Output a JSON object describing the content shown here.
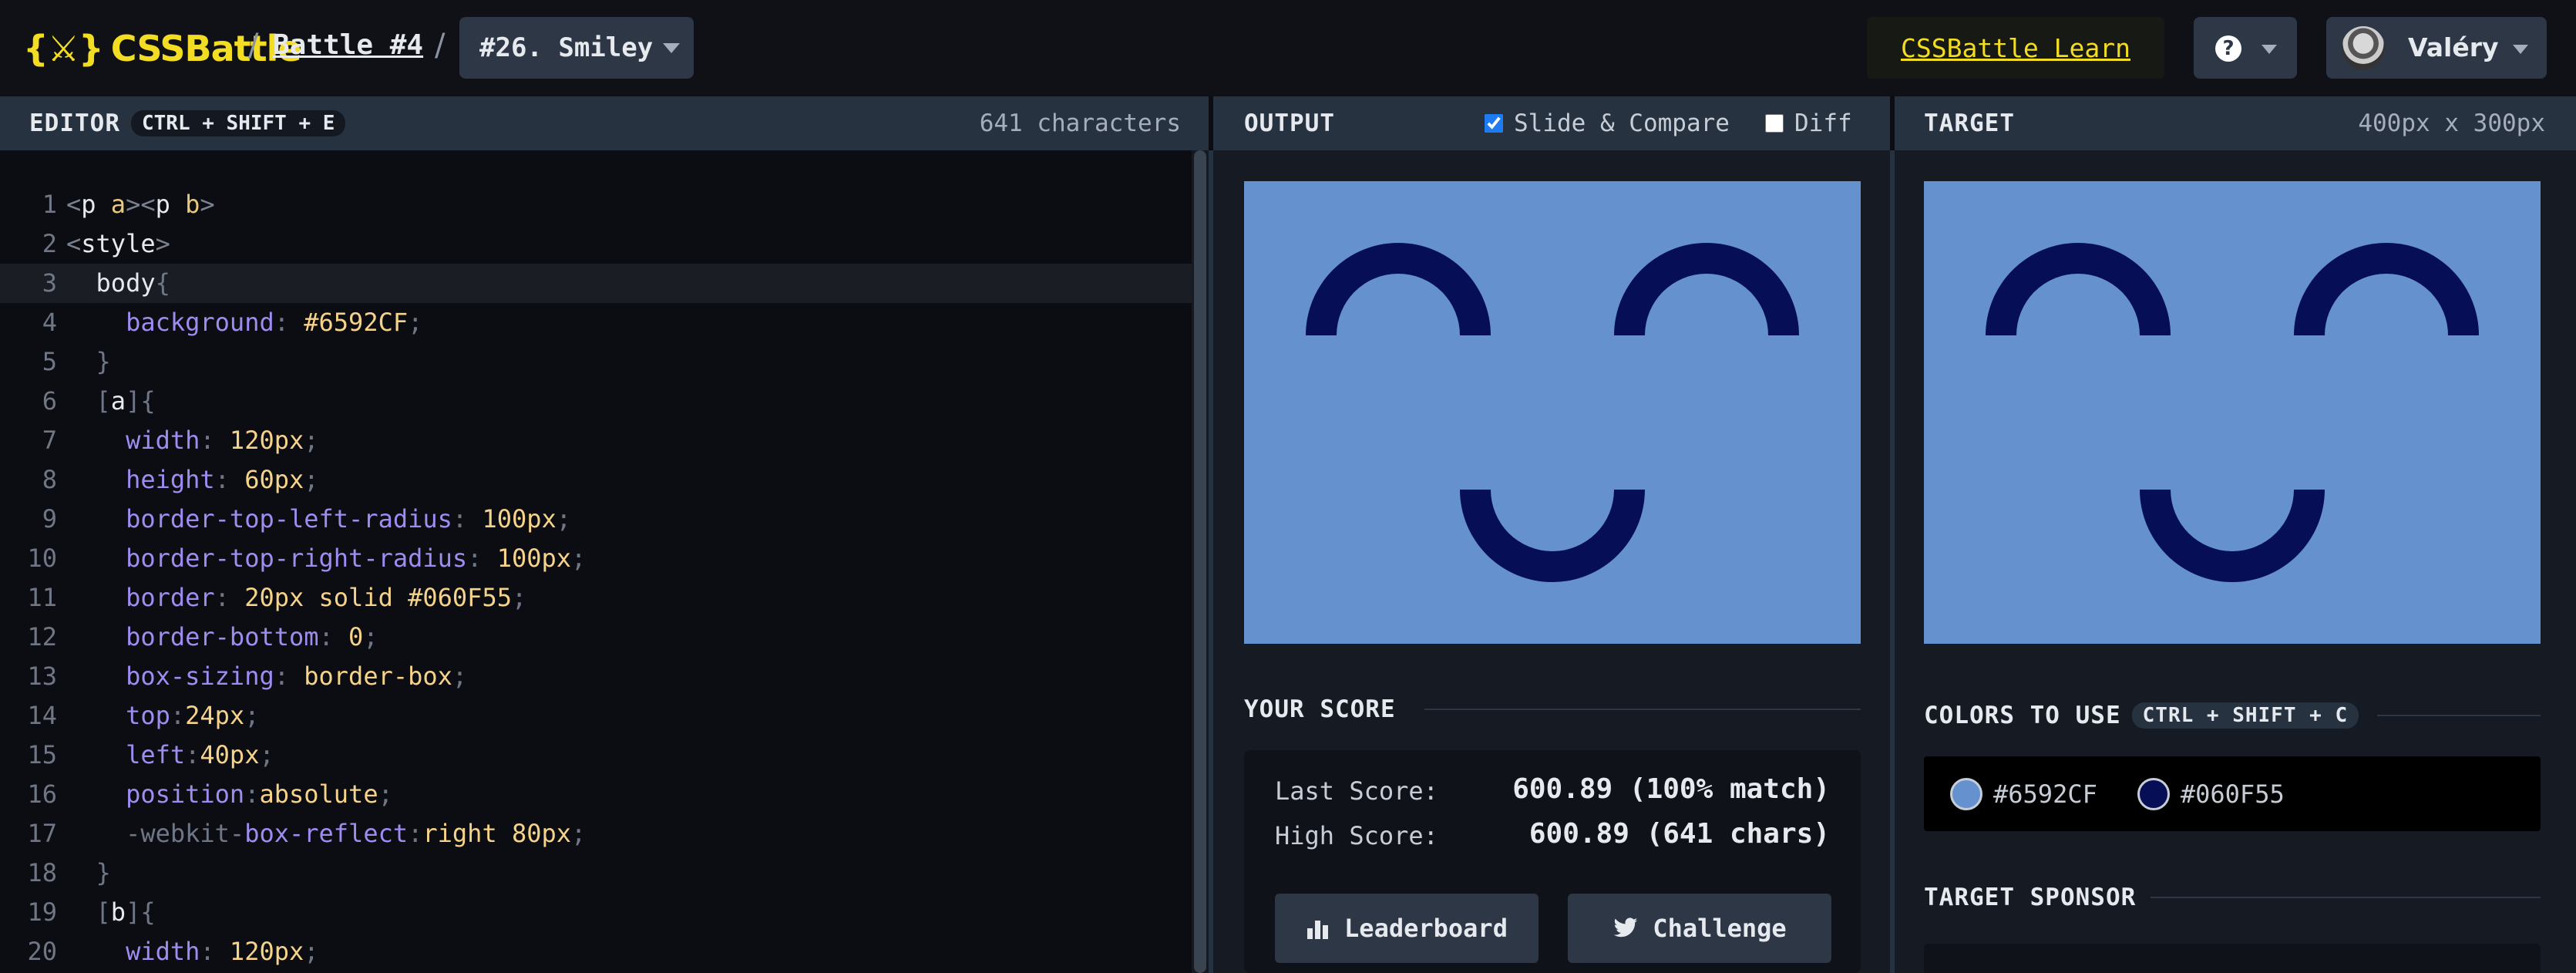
{
  "topbar": {
    "logo_text": "CSSBattle",
    "breadcrumb_sep1": "/",
    "battle_label": "Battle #4",
    "breadcrumb_sep2": "/",
    "target_select": "#26. Smiley",
    "learn_link": "CSSBattle Learn",
    "help_icon": "?",
    "user_name": "Valéry"
  },
  "editor": {
    "title": "EDITOR",
    "shortcut": "CTRL + SHIFT + E",
    "char_count": "641 characters",
    "active_line": 3,
    "lines": [
      "<p a><p b>",
      "<style>",
      "  body{",
      "    background: #6592CF;",
      "  }",
      "  [a]{",
      "    width: 120px;",
      "    height: 60px;",
      "    border-top-left-radius: 100px;",
      "    border-top-right-radius: 100px;",
      "    border: 20px solid #060F55;",
      "    border-bottom: 0;",
      "    box-sizing: border-box;",
      "    top:24px;",
      "    left:40px;",
      "    position:absolute;",
      "    -webkit-box-reflect:right 80px;",
      "  }",
      "  [b]{",
      "    width: 120px;"
    ]
  },
  "output": {
    "title": "OUTPUT",
    "slide_compare_label": "Slide & Compare",
    "slide_compare_checked": true,
    "diff_label": "Diff",
    "diff_checked": false
  },
  "target": {
    "title": "TARGET",
    "size": "400px x 300px"
  },
  "score": {
    "section_title": "YOUR SCORE",
    "last_label": "Last Score:",
    "last_value": "600.89 (100% match)",
    "high_label": "High Score:",
    "high_value": "600.89 (641 chars)",
    "leaderboard_button": "Leaderboard",
    "challenge_button": "Challenge"
  },
  "colors_to_use": {
    "section_title": "COLORS TO USE",
    "shortcut": "CTRL + SHIFT + C",
    "colors": [
      "#6592CF",
      "#060F55"
    ]
  },
  "sponsor": {
    "section_title": "TARGET SPONSOR"
  },
  "theme": {
    "accent": "#F3DD22",
    "background_color": "#6592CF",
    "shape_color": "#060F55"
  }
}
